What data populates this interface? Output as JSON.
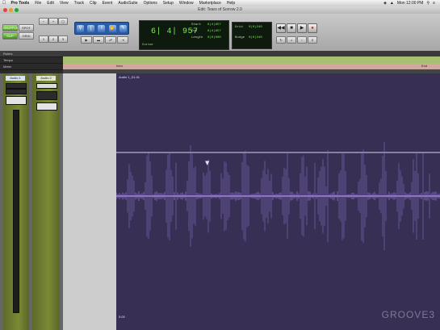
{
  "menubar": {
    "app_name": "Pro Tools",
    "items": [
      "File",
      "Edit",
      "View",
      "Track",
      "Clip",
      "Event",
      "AudioSuite",
      "Options",
      "Setup",
      "Window",
      "Marketplace",
      "Help"
    ],
    "clock": "Mon 12:00 PM"
  },
  "window": {
    "title": "Edit: Tears of Sorrow 2.0"
  },
  "toolbar": {
    "edit_modes": [
      "SHUFFLE",
      "SPOT",
      "SLIP",
      "GRID"
    ],
    "counter": {
      "main": "6| 4| 957",
      "start_label": "Start",
      "end_label": "End",
      "length_label": "Length",
      "start": "6|4|957",
      "end": "6|4|957",
      "length": "0|0|000",
      "grid_label": "Grid",
      "grid_value": "0|0|240",
      "nudge_label": "Nudge",
      "nudge_value": "0|0|240",
      "cursor_label": "Cursor"
    }
  },
  "left_panel": {
    "rows": [
      "Rulers",
      "Tempo",
      "Meter"
    ]
  },
  "mixer": {
    "track1_name": "Audio 1",
    "track2_name": "Audio 2"
  },
  "ruler": {
    "marker_left": "Intro",
    "marker_right": "End"
  },
  "clip": {
    "name": "Audio 1_01-01",
    "footer": "0:00"
  },
  "watermark": "GROOVE3",
  "colors": {
    "clip_bg": "#382f55",
    "waveform": "#8b73c9",
    "ruler_green": "#a6bf73",
    "ruler_pink": "#d4a6a0",
    "tool_blue": "#2a5da6",
    "lcd_green": "#7dea5a"
  }
}
